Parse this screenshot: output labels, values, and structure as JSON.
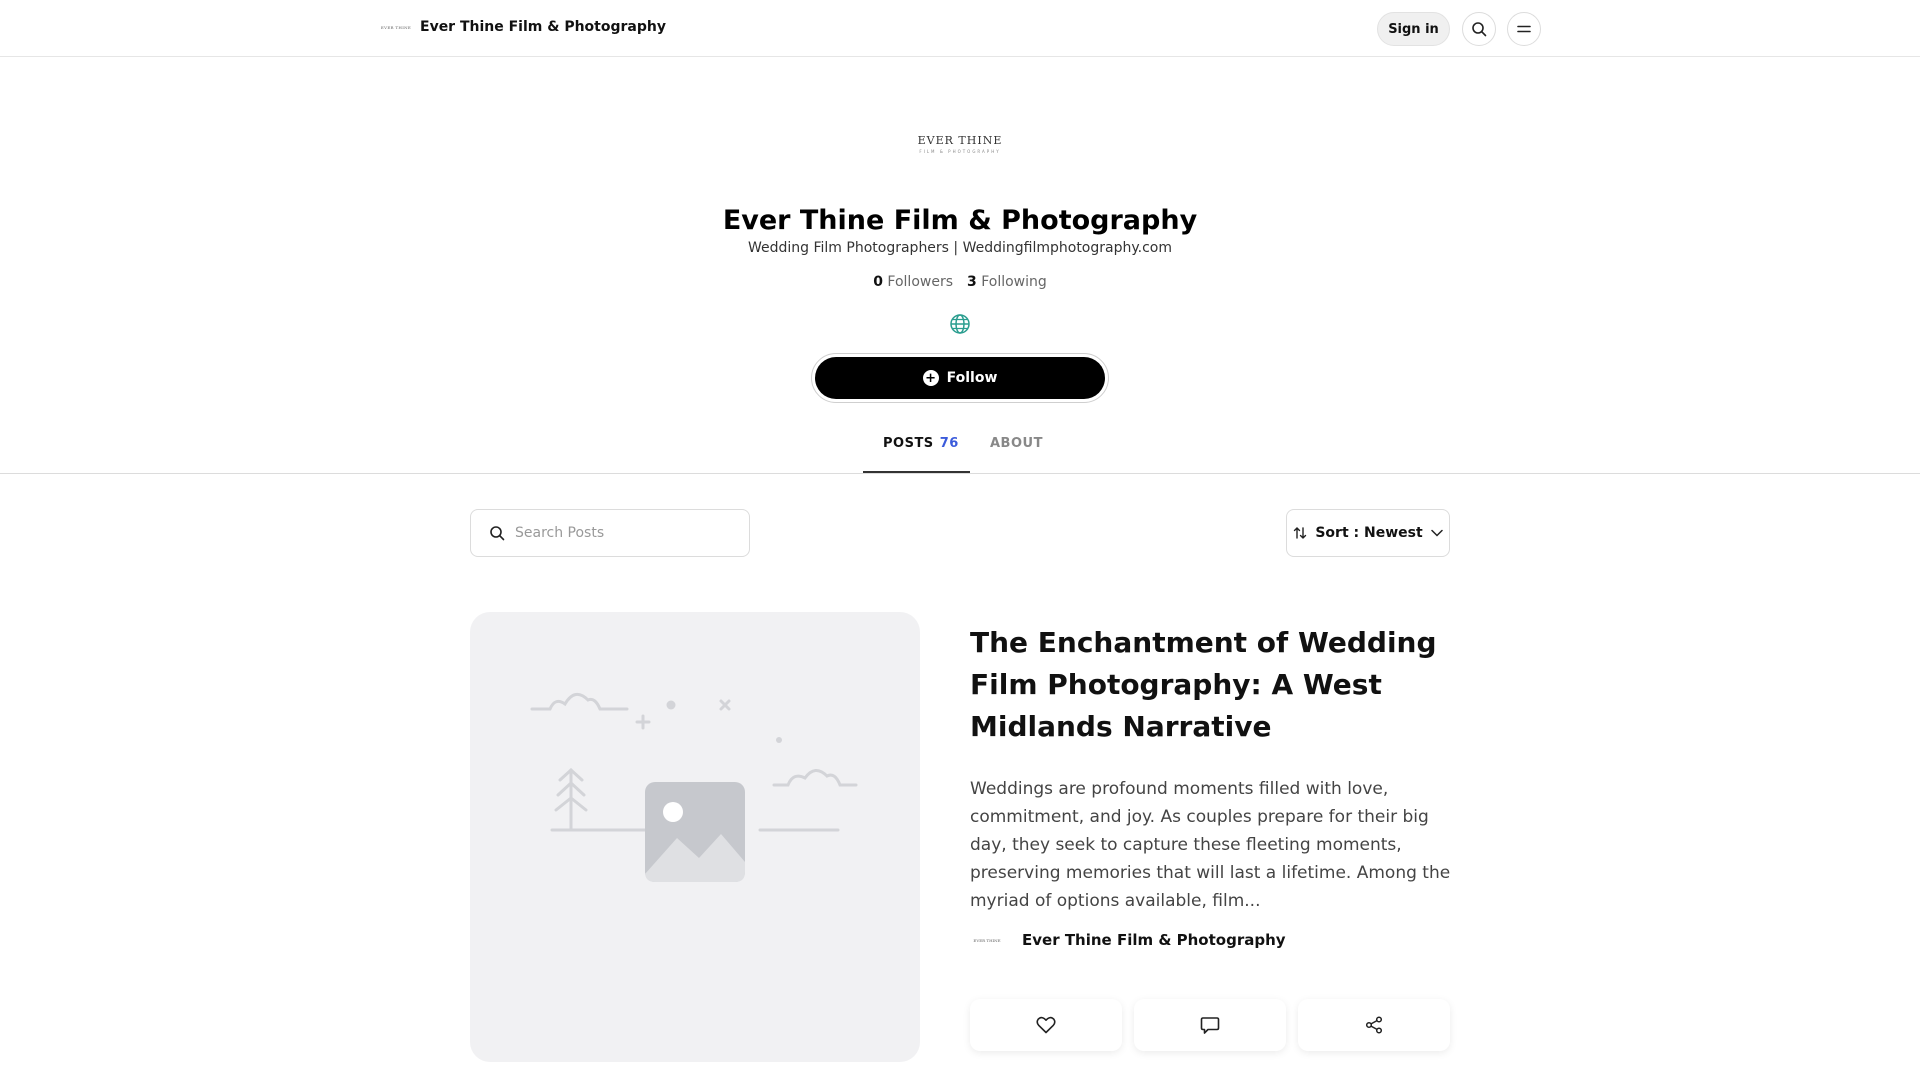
{
  "header": {
    "brand_logo_text": "EVER THINE",
    "brand_name": "Ever Thine Film & Photography",
    "signin_label": "Sign in",
    "icons": [
      "search-icon",
      "menu-icon"
    ]
  },
  "profile": {
    "logo_line1": "EVER THINE",
    "logo_line2": "FILM & PHOTOGRAPHY",
    "title": "Ever Thine Film & Photography",
    "subtitle": "Wedding Film Photographers | Weddingfilmphotography.com",
    "followers_count": "0",
    "followers_label": "Followers",
    "following_count": "3",
    "following_label": "Following",
    "globe_icon": "globe-icon",
    "follow_label": "Follow",
    "accent_color": "#2a9d8f"
  },
  "tabs": [
    {
      "label": "POSTS",
      "count": "76",
      "active": true
    },
    {
      "label": "ABOUT",
      "active": false
    }
  ],
  "toolbar": {
    "search_placeholder": "Search Posts",
    "search_value": "",
    "sort_label": "Sort : Newest"
  },
  "post": {
    "title": "The Enchantment of Wedding Film Photography: A West Midlands Narrative",
    "excerpt": "Weddings are profound moments filled with love, commitment, and joy. As couples prepare for their big day, they seek to capture these fleeting moments, preserving memories that will last a lifetime. Among the myriad of options available, film...",
    "author_logo_text": "EVER THINE",
    "author_name": "Ever Thine Film & Photography",
    "actions": [
      "heart-icon",
      "comment-icon",
      "share-icon"
    ]
  },
  "colors": {
    "tab_count": "#3b5bdb",
    "follow_bg": "#000000",
    "placeholder_bg": "#f1f1f3"
  }
}
